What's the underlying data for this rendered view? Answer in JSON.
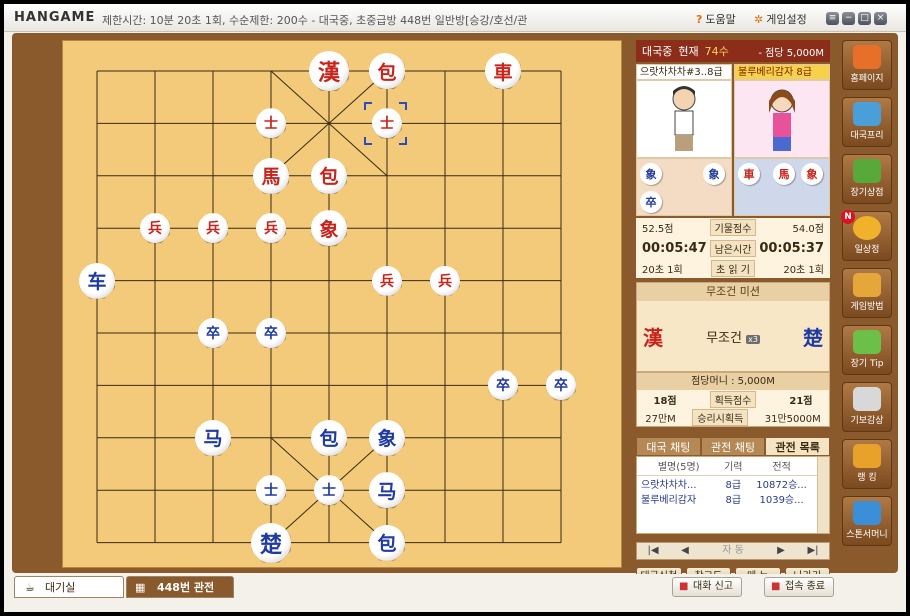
{
  "app": {
    "logo": "HANGAME",
    "info": "제한시간: 10분 20초 1회, 수순제한: 200수 - 대국중, 초중급방 448번 일반방[승강/호선/관",
    "help": "도움말",
    "settings": "게임설정"
  },
  "status": {
    "state": "대국중",
    "move_label": "현재",
    "move_count": "74수",
    "stake": "- 점당 5,000M"
  },
  "players": {
    "left": {
      "name": "으랏차차차#3..8급"
    },
    "right": {
      "name": "불루베리감자 8급"
    }
  },
  "captured": {
    "left": [
      "象",
      "象",
      "卒"
    ],
    "right": [
      "車",
      "馬",
      "象"
    ]
  },
  "stats": {
    "score_left": "52.5점",
    "score_label": "기물점수",
    "score_right": "54.0점",
    "time_left": "00:05:47",
    "time_label": "남은시간",
    "time_right": "00:05:37",
    "byo_left": "20초 1회",
    "byo_label": "초 읽 기",
    "byo_right": "20초 1회"
  },
  "mission": {
    "title": "무조건 미션",
    "left_glyph": "漢",
    "text": "무조건",
    "mult": "x3",
    "right_glyph": "楚"
  },
  "money": {
    "title": "점당머니 : 5,000M",
    "row1_left": "18점",
    "row1_mid": "획득점수",
    "row1_right": "21점",
    "row2_left": "27만M",
    "row2_mid": "승리시획득",
    "row2_right": "31만5000M"
  },
  "tabs": [
    "대국 채팅",
    "관전 채팅",
    "관전 목록"
  ],
  "spectators": {
    "headers": [
      "별명(5명)",
      "기력",
      "전적"
    ],
    "rows": [
      [
        "으랏차차차...",
        "8급",
        "10872승..."
      ],
      [
        "불루베리감자",
        "8급",
        "1039승..."
      ]
    ]
  },
  "nav": {
    "first": "|◀",
    "prev": "◀",
    "auto": "자 동",
    "next": "▶",
    "last": "▶|"
  },
  "buttons": {
    "request": "대국신청",
    "review": "참고도",
    "menu": "메 뉴",
    "exit": "나가기"
  },
  "side": [
    "홈페이지",
    "대국프리",
    "장기상점",
    "일상정",
    "게임방법",
    "장기 Tip",
    "기보감상",
    "랭 킹",
    "스톤서머니"
  ],
  "side_badge": "N",
  "bottom": {
    "tab1": "대기실",
    "tab2": "448번 관전",
    "report": "대화 신고",
    "exit": "접속 종료"
  },
  "pieces": [
    {
      "g": "漢",
      "c": "r",
      "s": "big",
      "col": 4,
      "row": 0
    },
    {
      "g": "包",
      "c": "r",
      "s": "mid",
      "col": 5,
      "row": 0
    },
    {
      "g": "車",
      "c": "r",
      "s": "mid",
      "col": 7,
      "row": 0
    },
    {
      "g": "士",
      "c": "r",
      "s": "sm",
      "col": 3,
      "row": 1
    },
    {
      "g": "士",
      "c": "r",
      "s": "sm",
      "col": 5,
      "row": 1
    },
    {
      "g": "馬",
      "c": "r",
      "s": "mid",
      "col": 3,
      "row": 2
    },
    {
      "g": "包",
      "c": "r",
      "s": "mid",
      "col": 4,
      "row": 2
    },
    {
      "g": "兵",
      "c": "r",
      "s": "sm",
      "col": 1,
      "row": 3
    },
    {
      "g": "兵",
      "c": "r",
      "s": "sm",
      "col": 2,
      "row": 3
    },
    {
      "g": "兵",
      "c": "r",
      "s": "sm",
      "col": 3,
      "row": 3
    },
    {
      "g": "象",
      "c": "r",
      "s": "mid",
      "col": 4,
      "row": 3
    },
    {
      "g": "车",
      "c": "b",
      "s": "mid",
      "col": 0,
      "row": 4
    },
    {
      "g": "兵",
      "c": "r",
      "s": "sm",
      "col": 5,
      "row": 4
    },
    {
      "g": "兵",
      "c": "r",
      "s": "sm",
      "col": 6,
      "row": 4
    },
    {
      "g": "卒",
      "c": "b",
      "s": "sm",
      "col": 2,
      "row": 5
    },
    {
      "g": "卒",
      "c": "b",
      "s": "sm",
      "col": 3,
      "row": 5
    },
    {
      "g": "卒",
      "c": "b",
      "s": "sm",
      "col": 7,
      "row": 6
    },
    {
      "g": "卒",
      "c": "b",
      "s": "sm",
      "col": 8,
      "row": 6
    },
    {
      "g": "马",
      "c": "b",
      "s": "mid",
      "col": 2,
      "row": 7
    },
    {
      "g": "包",
      "c": "b",
      "s": "mid",
      "col": 4,
      "row": 7
    },
    {
      "g": "象",
      "c": "b",
      "s": "mid",
      "col": 5,
      "row": 7
    },
    {
      "g": "士",
      "c": "b",
      "s": "sm",
      "col": 3,
      "row": 8
    },
    {
      "g": "士",
      "c": "b",
      "s": "sm",
      "col": 4,
      "row": 8
    },
    {
      "g": "马",
      "c": "b",
      "s": "mid",
      "col": 5,
      "row": 8
    },
    {
      "g": "楚",
      "c": "b",
      "s": "big",
      "col": 3,
      "row": 9
    },
    {
      "g": "包",
      "c": "b",
      "s": "mid",
      "col": 5,
      "row": 9
    }
  ]
}
